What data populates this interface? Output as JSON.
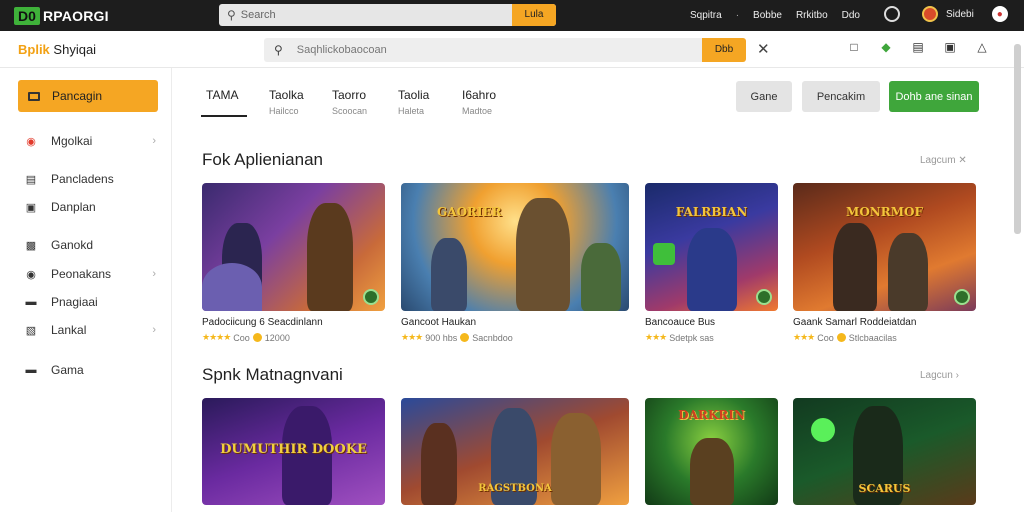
{
  "topbar": {
    "logo_mark": "D0",
    "logo_text": "RPAORGI",
    "search_placeholder": "Search",
    "search_button": "Lula",
    "links": [
      "Sqpitra",
      "Bobbe",
      "Rrkitbo",
      "Ddo"
    ],
    "user_label": "Sidebi"
  },
  "secbar": {
    "brand_accent": "Bplik",
    "brand_text": "Shyiqai",
    "search_placeholder": "Saqhlickobaocoan",
    "search_button": "Dbb"
  },
  "sidebar": {
    "primary": "Pancagin",
    "items": [
      {
        "label": "Mgolkai",
        "icon": "game-icon",
        "chevron": true
      },
      {
        "label": "Pancladens",
        "icon": "doc-icon",
        "chevron": false
      },
      {
        "label": "Danplan",
        "icon": "layout-icon",
        "chevron": false
      },
      {
        "label": "Ganokd",
        "icon": "user-icon",
        "chevron": false
      },
      {
        "label": "Peonakans",
        "icon": "circle-icon",
        "chevron": true
      },
      {
        "label": "Pnagiaai",
        "icon": "folder-icon",
        "chevron": false
      },
      {
        "label": "Lankal",
        "icon": "tag-icon",
        "chevron": true
      },
      {
        "label": "Gama",
        "icon": "stack-icon",
        "chevron": false
      }
    ]
  },
  "tabs": [
    {
      "label": "TAMA",
      "sub": ""
    },
    {
      "label": "Taolka",
      "sub": "Hailcco"
    },
    {
      "label": "Taorro",
      "sub": "Scoocan"
    },
    {
      "label": "Taolia",
      "sub": "Haleta"
    },
    {
      "label": "I6ahro",
      "sub": "Madtoe"
    }
  ],
  "actions": {
    "game": "Gane",
    "secondary": "Pencakim",
    "primary": "Dohb ane sinan"
  },
  "sections": [
    {
      "title": "Fok Aplienianan",
      "see_all": "Lagcum",
      "cards": [
        {
          "name": "Padociicung 6 Seacdinlann",
          "rating": "Coo",
          "price": "12000",
          "art_title": "",
          "theme": "purple"
        },
        {
          "name": "Gancoot Haukan",
          "rating": "900 hbs",
          "price": "Sacnbdoo",
          "art_title": "GAORIER",
          "theme": "gold"
        },
        {
          "name": "Bancoauce Bus",
          "rating": "",
          "price": "Sdetpk sas",
          "art_title": "FALRBIAN",
          "theme": "blue"
        },
        {
          "name": "Gaank Samarl Roddeiatdan",
          "rating": "Coo",
          "price": "Stlcbaacilas",
          "art_title": "MONRMOF",
          "theme": "red"
        }
      ]
    },
    {
      "title": "Spnk Matnagnvani",
      "see_all": "Lagcun",
      "cards": [
        {
          "name": "",
          "rating": "",
          "price": "",
          "art_title": "DUMUTHIR DOOKE",
          "theme": "violet"
        },
        {
          "name": "",
          "rating": "",
          "price": "",
          "art_title": "RAGSTBONA",
          "theme": "orange"
        },
        {
          "name": "",
          "rating": "",
          "price": "",
          "art_title": "DARKRIN",
          "theme": "green"
        },
        {
          "name": "",
          "rating": "",
          "price": "",
          "art_title": "SCARUS",
          "theme": "darkgreen"
        }
      ]
    }
  ],
  "colors": {
    "accent": "#f5a623",
    "primary_green": "#3fa63b",
    "topbar": "#1d1d1d"
  }
}
